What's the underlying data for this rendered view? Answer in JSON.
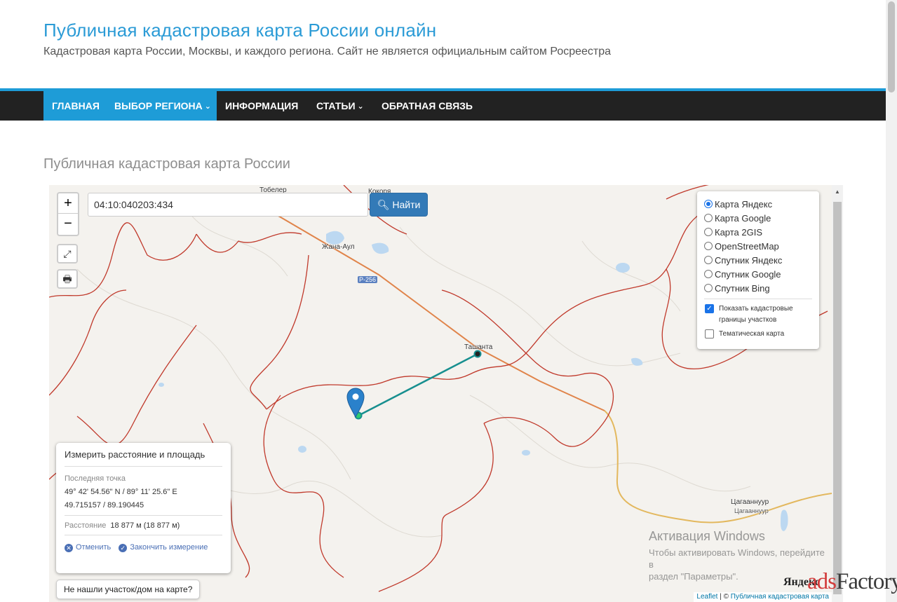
{
  "site": {
    "title": "Публичная кадастровая карта России онлайн",
    "description": "Кадастровая карта России, Москвы, и каждого региона. Сайт не является официальным сайтом Росреестра"
  },
  "nav": {
    "items": [
      {
        "label": "ГЛАВНАЯ",
        "active": true
      },
      {
        "label": "ВЫБОР РЕГИОНА",
        "active": true,
        "has_dropdown": true
      },
      {
        "label": "ИНФОРМАЦИЯ",
        "active": false
      },
      {
        "label": "СТАТЬИ",
        "active": false,
        "has_dropdown": true
      },
      {
        "label": "ОБРАТНАЯ СВЯЗЬ",
        "active": false
      }
    ]
  },
  "page_heading": "Публичная кадастровая карта России",
  "map": {
    "zoom_in": "+",
    "zoom_out": "−",
    "search": {
      "value": "04:10:040203:434",
      "button": "Найти"
    },
    "place_labels": [
      "Тобелер",
      "Кокоря",
      "Жана-Аул",
      "Р-256",
      "Ташанта",
      "Цагааннуур",
      "Цагааннуур"
    ],
    "layers": {
      "options": [
        {
          "label": "Карта Яндекс",
          "selected": true
        },
        {
          "label": "Карта Google",
          "selected": false
        },
        {
          "label": "Карта 2GIS",
          "selected": false
        },
        {
          "label": "OpenStreetMap",
          "selected": false
        },
        {
          "label": "Спутник Яндекс",
          "selected": false
        },
        {
          "label": "Спутник Google",
          "selected": false
        },
        {
          "label": "Спутник Bing",
          "selected": false
        }
      ],
      "checkboxes": [
        {
          "label": "Показать кадастровые границы участков",
          "checked": true
        },
        {
          "label": "Тематическая карта",
          "checked": false
        }
      ]
    },
    "measure": {
      "title": "Измерить расстояние и площадь",
      "last_point_label": "Последняя точка",
      "dms": "49° 42' 54.56\" N / 89° 11' 25.6\" E",
      "decimal": "49.715157 / 89.190445",
      "distance_label": "Расстояние",
      "distance_value": "18 877 м (18 877 м)",
      "cancel": "Отменить",
      "finish": "Закончить измерение"
    },
    "not_found": "Не нашли участок/дом на карте?",
    "activation": {
      "title": "Активация Windows",
      "line1": "Чтобы активировать Windows, перейдите в",
      "line2": "раздел \"Параметры\"."
    },
    "yandex_logo": "Яндекс",
    "attribution": {
      "leaflet": "Leaflet",
      "sep": " | © ",
      "site": "Публичная кадастровая карта"
    },
    "colors": {
      "boundary": "#c0392b",
      "road": "#e08a4a",
      "measure_line": "#178f8f",
      "marker": "#2a81cb"
    }
  },
  "watermark": {
    "red": "ads",
    "dark": "Factory"
  }
}
